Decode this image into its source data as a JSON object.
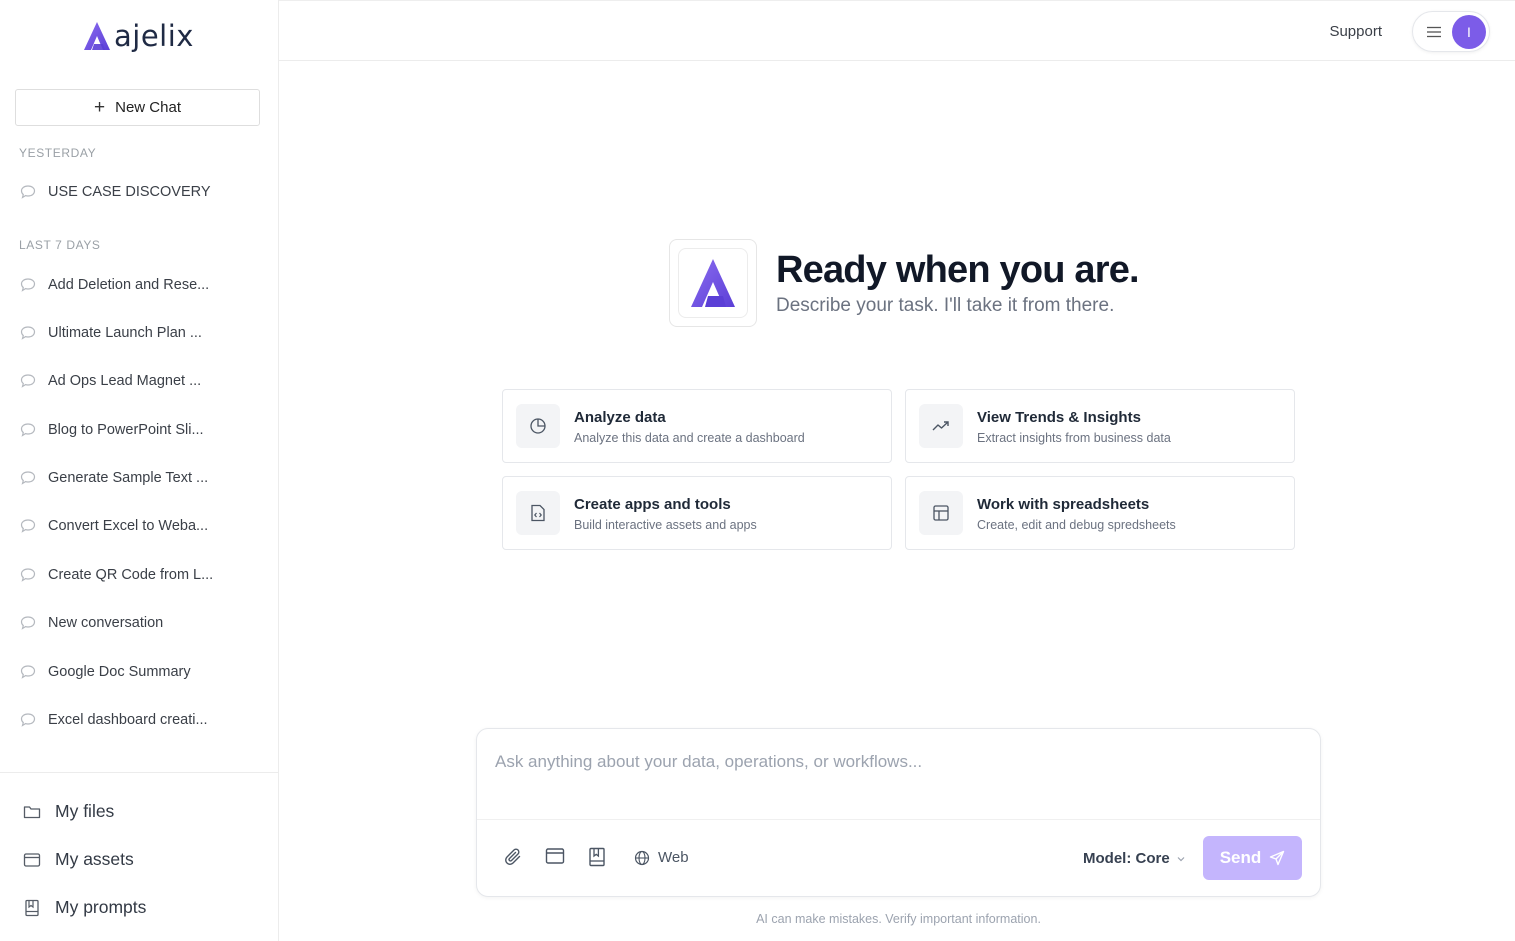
{
  "brand": {
    "name": "ajelix",
    "accent": "#7c5ce8"
  },
  "sidebar": {
    "new_chat_label": "New Chat",
    "sections": [
      {
        "label": "YESTERDAY",
        "items": [
          "USE CASE DISCOVERY"
        ]
      },
      {
        "label": "LAST 7 DAYS",
        "items": [
          "Add Deletion and Rese...",
          "Ultimate Launch Plan ...",
          "Ad Ops Lead Magnet ...",
          "Blog to PowerPoint Sli...",
          "Generate Sample Text ...",
          "Convert Excel to Weba...",
          "Create QR Code from L...",
          "New conversation",
          "Google Doc Summary",
          "Excel dashboard creati..."
        ]
      }
    ],
    "footer": [
      {
        "label": "My files",
        "icon": "folder-icon"
      },
      {
        "label": "My assets",
        "icon": "window-icon"
      },
      {
        "label": "My prompts",
        "icon": "bookmark-book-icon"
      }
    ]
  },
  "topbar": {
    "support_label": "Support",
    "avatar_initial": "I"
  },
  "hero": {
    "title": "Ready when you are.",
    "subtitle": "Describe your task. I'll take it from there."
  },
  "cards": [
    {
      "title": "Analyze data",
      "subtitle": "Analyze this data and create a dashboard",
      "icon": "pie-chart-icon"
    },
    {
      "title": "View Trends & Insights",
      "subtitle": "Extract insights from business data",
      "icon": "trending-up-icon"
    },
    {
      "title": "Create apps and tools",
      "subtitle": "Build interactive assets and apps",
      "icon": "code-file-icon"
    },
    {
      "title": "Work with spreadsheets",
      "subtitle": "Create, edit and debug spredsheets",
      "icon": "table-icon"
    }
  ],
  "composer": {
    "placeholder": "Ask anything about your data, operations, or workflows...",
    "web_label": "Web",
    "model_label": "Model: Core",
    "send_label": "Send"
  },
  "disclaimer": "AI can make mistakes. Verify important information."
}
